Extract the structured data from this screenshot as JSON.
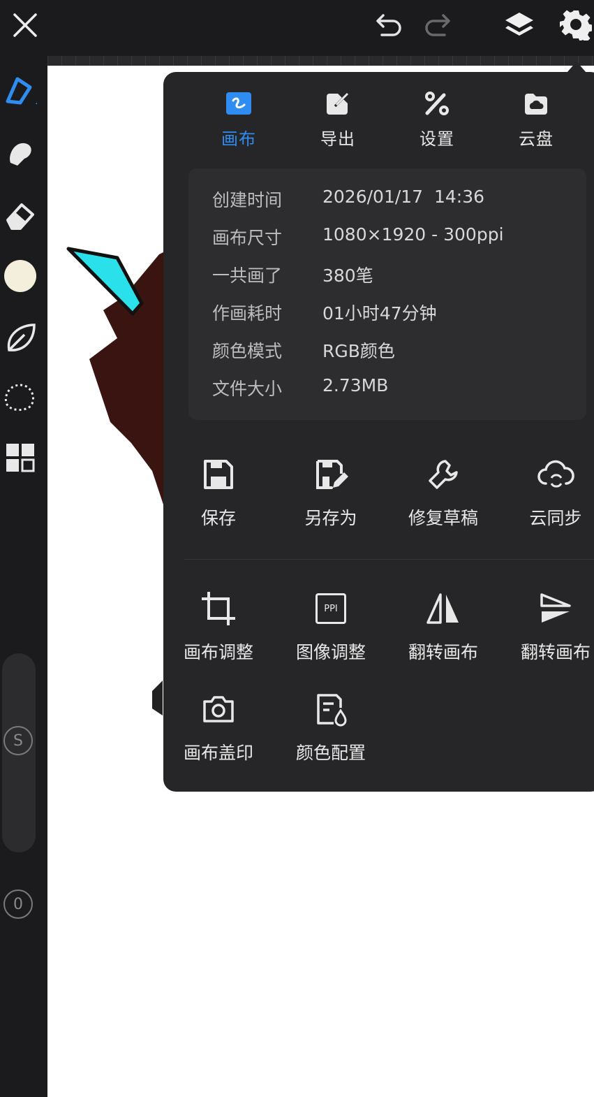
{
  "topbar": {
    "close_icon": "close-icon",
    "undo_icon": "undo-icon",
    "redo_icon": "redo-icon",
    "layers_icon": "layers-icon",
    "settings_icon": "gear-icon"
  },
  "sidebar": {
    "tools": [
      "pen-tool-icon",
      "smudge-icon",
      "eraser-icon",
      "color-swatch",
      "leaf-brush-icon",
      "lasso-select-icon",
      "grid-tools-icon"
    ],
    "color_swatch": "#f4efdc",
    "size_badge": "S",
    "opacity_badge": "0"
  },
  "panel": {
    "tabs": [
      {
        "label": "画布",
        "icon": "canvas-icon",
        "active": true
      },
      {
        "label": "导出",
        "icon": "export-icon",
        "active": false
      },
      {
        "label": "设置",
        "icon": "settings-tools-icon",
        "active": false
      },
      {
        "label": "云盘",
        "icon": "cloud-drive-icon",
        "active": false
      }
    ],
    "info": [
      {
        "key": "创建时间",
        "value": "2026/01/17  14:36"
      },
      {
        "key": "画布尺寸",
        "value": "1080×1920 - 300ppi"
      },
      {
        "key": "一共画了",
        "value": "380笔"
      },
      {
        "key": "作画耗时",
        "value": "01小时47分钟"
      },
      {
        "key": "颜色模式",
        "value": "RGB颜色"
      },
      {
        "key": "文件大小",
        "value": "2.73MB"
      }
    ],
    "actions_row1": [
      {
        "label": "保存",
        "icon": "save-icon"
      },
      {
        "label": "另存为",
        "icon": "save-as-icon"
      },
      {
        "label": "修复草稿",
        "icon": "wrench-icon"
      },
      {
        "label": "云同步",
        "icon": "cloud-sync-icon"
      }
    ],
    "actions_row2": [
      {
        "label": "画布调整",
        "icon": "crop-icon"
      },
      {
        "label": "图像调整",
        "icon": "ppi-icon"
      },
      {
        "label": "翻转画布",
        "icon": "flip-horizontal-icon"
      },
      {
        "label": "翻转画布",
        "icon": "flip-vertical-icon"
      }
    ],
    "actions_row3": [
      {
        "label": "画布盖印",
        "icon": "camera-icon"
      },
      {
        "label": "颜色配置",
        "icon": "color-profile-icon"
      }
    ],
    "ppi_text": "PPI"
  },
  "colors": {
    "accent": "#2f8cf0",
    "panel_bg": "#262628",
    "info_bg": "#2d2d30",
    "canvas": "#ffffff"
  }
}
